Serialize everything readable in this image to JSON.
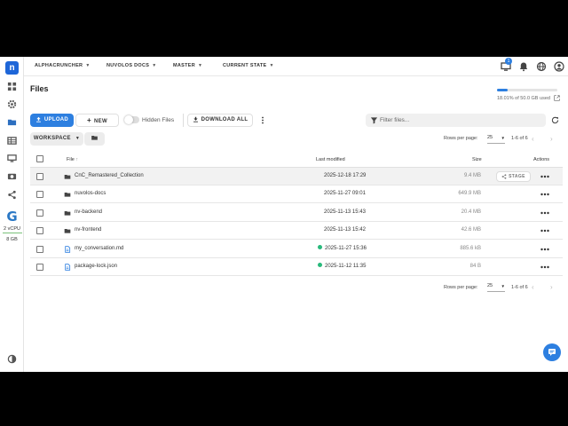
{
  "nav": {
    "crumbs": [
      {
        "label": "ALPHACRUNCHER"
      },
      {
        "label": "NUVOLOS DOCS"
      },
      {
        "label": "MASTER"
      },
      {
        "label": "CURRENT STATE"
      }
    ],
    "notification_count": "1"
  },
  "sidebar": {
    "icons": [
      "dashboard-icon",
      "settings-icon",
      "folder-icon",
      "table-icon",
      "monitor-icon",
      "camera-icon",
      "share-icon",
      "theme-icon"
    ],
    "app_logo": "G",
    "vcpu": "2 vCPU",
    "memory": "8 GB"
  },
  "page": {
    "title": "Files",
    "storage_text": "18.01% of 50.0 GB used",
    "storage_percent": 18.01
  },
  "toolbar": {
    "upload": "UPLOAD",
    "new": "NEW",
    "hidden_files": "Hidden Files",
    "download_all": "DOWNLOAD ALL",
    "filter_placeholder": "Filter files...",
    "workspace": "WORKSPACE"
  },
  "pagination": {
    "rows_per_page_label": "Rows per page:",
    "rows_per_page": "25",
    "range": "1-6 of 6"
  },
  "table": {
    "headers": {
      "file": "File",
      "last_modified": "Last modified",
      "size": "Size",
      "actions": "Actions"
    },
    "rows": [
      {
        "type": "folder",
        "name": "CnC_Remastered_Collection",
        "modified": "2025-12-18 17:29",
        "size": "9.4 MB",
        "status": false,
        "stage": "STAGE"
      },
      {
        "type": "folder",
        "name": "nuvolos-docs",
        "modified": "2025-11-27 09:01",
        "size": "649.9 MB",
        "status": false
      },
      {
        "type": "folder",
        "name": "nv-backend",
        "modified": "2025-11-13 15:43",
        "size": "20.4 MB",
        "status": false
      },
      {
        "type": "folder",
        "name": "nv-frontend",
        "modified": "2025-11-13 15:42",
        "size": "42.6 MB",
        "status": false
      },
      {
        "type": "file",
        "name": "my_conversation.md",
        "modified": "2025-11-27 15:36",
        "size": "885.6 kB",
        "status": true
      },
      {
        "type": "file",
        "name": "package-lock.json",
        "modified": "2025-11-12 11:35",
        "size": "84 B",
        "status": true
      }
    ]
  }
}
